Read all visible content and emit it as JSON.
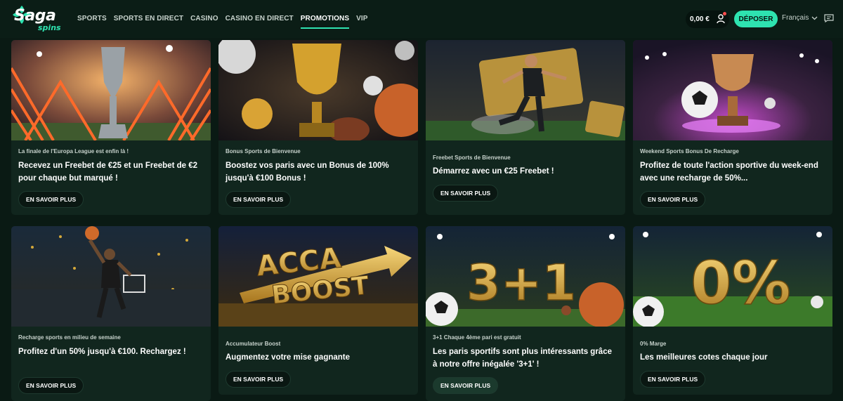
{
  "brand": {
    "name_main": "Saga",
    "name_sub": "spins"
  },
  "nav": [
    {
      "label": "SPORTS",
      "active": false
    },
    {
      "label": "SPORTS EN DIRECT",
      "active": false
    },
    {
      "label": "CASINO",
      "active": false
    },
    {
      "label": "CASINO EN DIRECT",
      "active": false
    },
    {
      "label": "PROMOTIONS",
      "active": true
    },
    {
      "label": "VIP",
      "active": false
    }
  ],
  "header": {
    "balance": "0,00 €",
    "deposit_label": "DÉPOSER",
    "language": "Français"
  },
  "promos": [
    {
      "subtitle": "La finale de l'Europa League est enfin là !",
      "title": "Recevez un Freebet de €25 et un Freebet de €2 pour chaque but marqué !",
      "button": "EN SAVOIR PLUS",
      "image": "europa-trophy"
    },
    {
      "subtitle": "Bonus Sports de Bienvenue",
      "title": "Boostez vos paris avec un Bonus de 100% jusqu'à €100 Bonus !",
      "button": "EN SAVOIR PLUS",
      "image": "gold-trophy-balls"
    },
    {
      "subtitle": "Freebet Sports de Bienvenue",
      "title": "Démarrez avec un €25 Freebet !",
      "button": "EN SAVOIR PLUS",
      "image": "footballer-ticket"
    },
    {
      "subtitle": "Weekend Sports Bonus De Recharge",
      "title": "Profitez de toute l'action sportive du week-end avec une recharge de 50%...",
      "button": "EN SAVOIR PLUS",
      "image": "trophy-football"
    },
    {
      "subtitle": "Recharge sports en milieu de semaine",
      "title": "Profitez d'un 50% jusqu'à €100. Rechargez !",
      "button": "EN SAVOIR PLUS",
      "image": "basketball-player"
    },
    {
      "subtitle": "Accumulateur Boost",
      "title": "Augmentez votre mise gagnante",
      "button": "EN SAVOIR PLUS",
      "image": "acca-boost",
      "image_text_1": "ACCA",
      "image_text_2": "BOOST"
    },
    {
      "subtitle": "3+1 Chaque 4ème pari est gratuit",
      "title": "Les paris sportifs sont plus intéressants grâce à notre offre inégalée '3+1' !",
      "button": "EN SAVOIR PLUS",
      "image": "three-plus-one",
      "image_text_1": "3+1"
    },
    {
      "subtitle": "0% Marge",
      "title": "Les meilleures cotes chaque jour",
      "button": "EN SAVOIR PLUS",
      "image": "zero-percent",
      "image_text_1": "0%"
    }
  ],
  "colors": {
    "accent": "#2ee3b0",
    "card_bg": "#11261e",
    "page_bg": "#0a1a14"
  }
}
